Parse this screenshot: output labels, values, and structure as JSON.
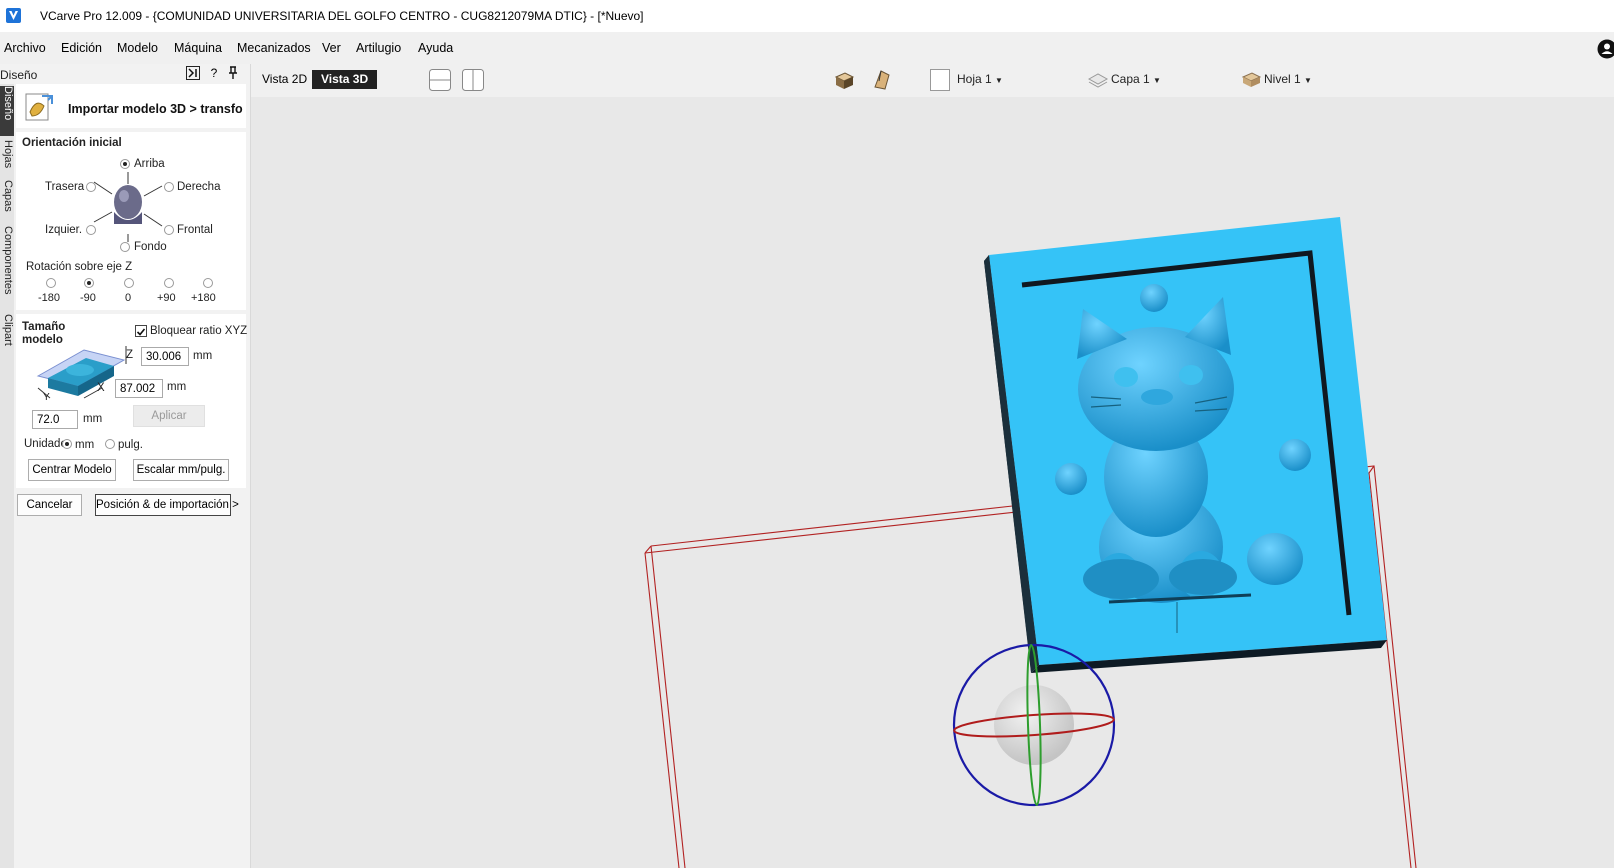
{
  "window": {
    "title": "VCarve Pro 12.009 - {COMUNIDAD UNIVERSITARIA DEL GOLFO CENTRO - CUG8212079MA DTIC} - [*Nuevo]"
  },
  "menu": {
    "items": [
      "Archivo",
      "Edición",
      "Modelo",
      "Máquina",
      "Mecanizados",
      "Ver",
      "Artilugio",
      "Ayuda"
    ]
  },
  "panel": {
    "title": "Diseño",
    "tabs": [
      "Diseño",
      "Hojas",
      "Capas",
      "Componentes",
      "Clipart"
    ],
    "tool_help": "?",
    "import_title": "Importar modelo 3D > transfo",
    "orientation": {
      "label": "Orientación inicial",
      "options": {
        "top": "Arriba",
        "back": "Trasera",
        "right": "Derecha",
        "left": "Izquier.",
        "front": "Frontal",
        "bottom": "Fondo"
      },
      "selected": "Arriba"
    },
    "rotation": {
      "label": "Rotación sobre eje Z",
      "options": [
        "-180",
        "-90",
        "0",
        "+90",
        "+180"
      ],
      "selected": "-90"
    },
    "size": {
      "label_line1": "Tamaño",
      "label_line2": "modelo",
      "lock_label": "Bloquear ratio XYZ",
      "lock_checked": true,
      "z_axis": "Z",
      "x_axis": "X",
      "y_axis": "Y",
      "z_value": "30.006",
      "x_value": "87.002",
      "y_value": "72.0",
      "unit": "mm",
      "apply_label": "Aplicar"
    },
    "units": {
      "label": "Unidade",
      "mm": "mm",
      "inch": "pulg.",
      "selected": "mm"
    },
    "center_button": "Centrar Modelo",
    "scale_button": "Escalar mm/pulg.",
    "cancel_button": "Cancelar",
    "next_button": "Posición & de importación >"
  },
  "toolbar": {
    "view2d": "Vista 2D",
    "view3d": "Vista 3D",
    "active_view": "Vista 3D",
    "sheet": "Hoja 1",
    "layer": "Capa 1",
    "level": "Nivel 1"
  },
  "colors": {
    "model": "#29b6f6",
    "accent": "#1e73d8",
    "bounding_box": "#b22222",
    "gizmo_blue": "#1a1aa6",
    "gizmo_green": "#2e9e2e",
    "gizmo_red": "#b01c1c"
  }
}
